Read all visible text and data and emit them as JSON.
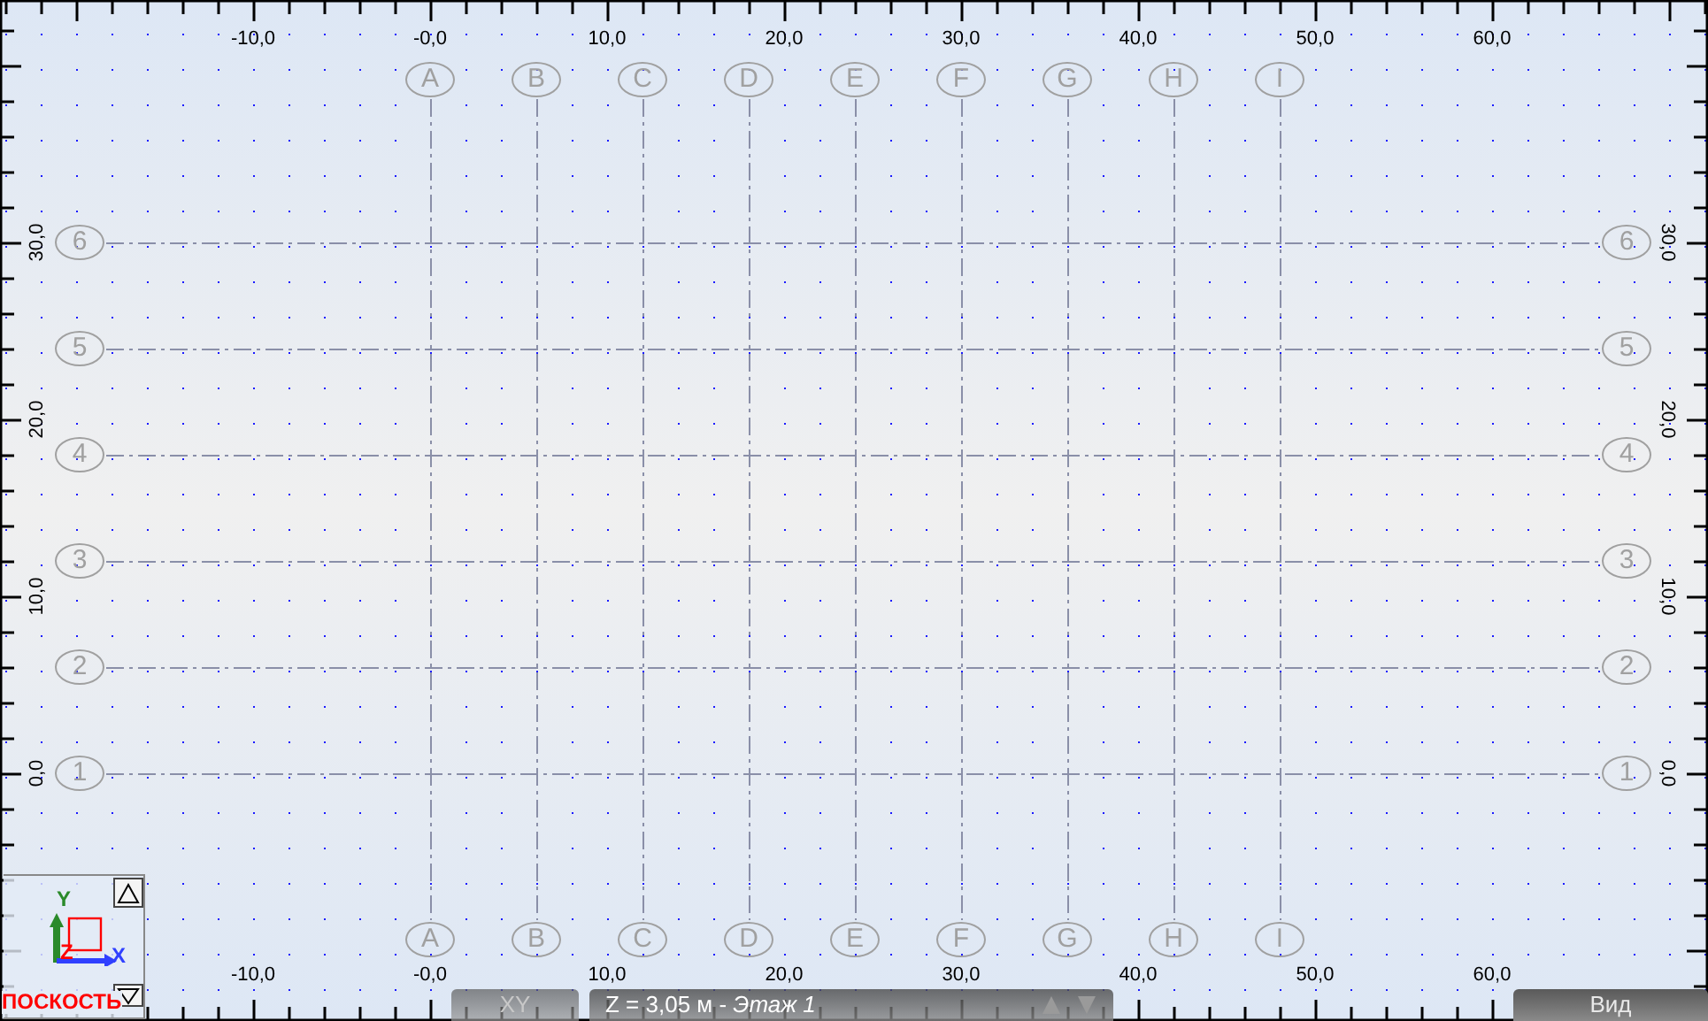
{
  "ruler_top": {
    "labels": [
      "-10,0",
      "-0,0",
      "10,0",
      "20,0",
      "30,0",
      "40,0",
      "50,0",
      "60,0"
    ]
  },
  "ruler_bottom": {
    "labels": [
      "-10,0",
      "-0,0",
      "10,0",
      "20,0",
      "30,0",
      "40,0",
      "50,0",
      "60,0"
    ]
  },
  "ruler_left": {
    "labels": [
      "30,0",
      "20,0",
      "10,0",
      "0,0"
    ]
  },
  "ruler_right": {
    "labels": [
      "30,0",
      "20,0",
      "10,0",
      "0,0"
    ]
  },
  "grid_axes": {
    "columns_top": [
      {
        "label": "A"
      },
      {
        "label": "B"
      },
      {
        "label": "C"
      },
      {
        "label": "D"
      },
      {
        "label": "E"
      },
      {
        "label": "F"
      },
      {
        "label": "G"
      },
      {
        "label": "H"
      },
      {
        "label": "I"
      }
    ],
    "columns_bottom": [
      {
        "label": "A"
      },
      {
        "label": "B"
      },
      {
        "label": "C"
      },
      {
        "label": "D"
      },
      {
        "label": "E"
      },
      {
        "label": "F"
      },
      {
        "label": "G"
      },
      {
        "label": "H"
      },
      {
        "label": "I"
      }
    ],
    "rows_left": [
      {
        "label": "6"
      },
      {
        "label": "5"
      },
      {
        "label": "4"
      },
      {
        "label": "3"
      },
      {
        "label": "2"
      },
      {
        "label": "1"
      }
    ],
    "rows_right": [
      {
        "label": "6"
      },
      {
        "label": "5"
      },
      {
        "label": "4"
      },
      {
        "label": "3"
      },
      {
        "label": "2"
      },
      {
        "label": "1"
      }
    ]
  },
  "view_widget": {
    "axis_y": "Y",
    "axis_x": "X",
    "axis_z": "Z",
    "plane_label": "ПОСКОСТЬ"
  },
  "bottom_bar": {
    "plane_button": "XY",
    "level": "Z = 3,05 м - *Этаж 1*",
    "view_button": "Вид"
  }
}
